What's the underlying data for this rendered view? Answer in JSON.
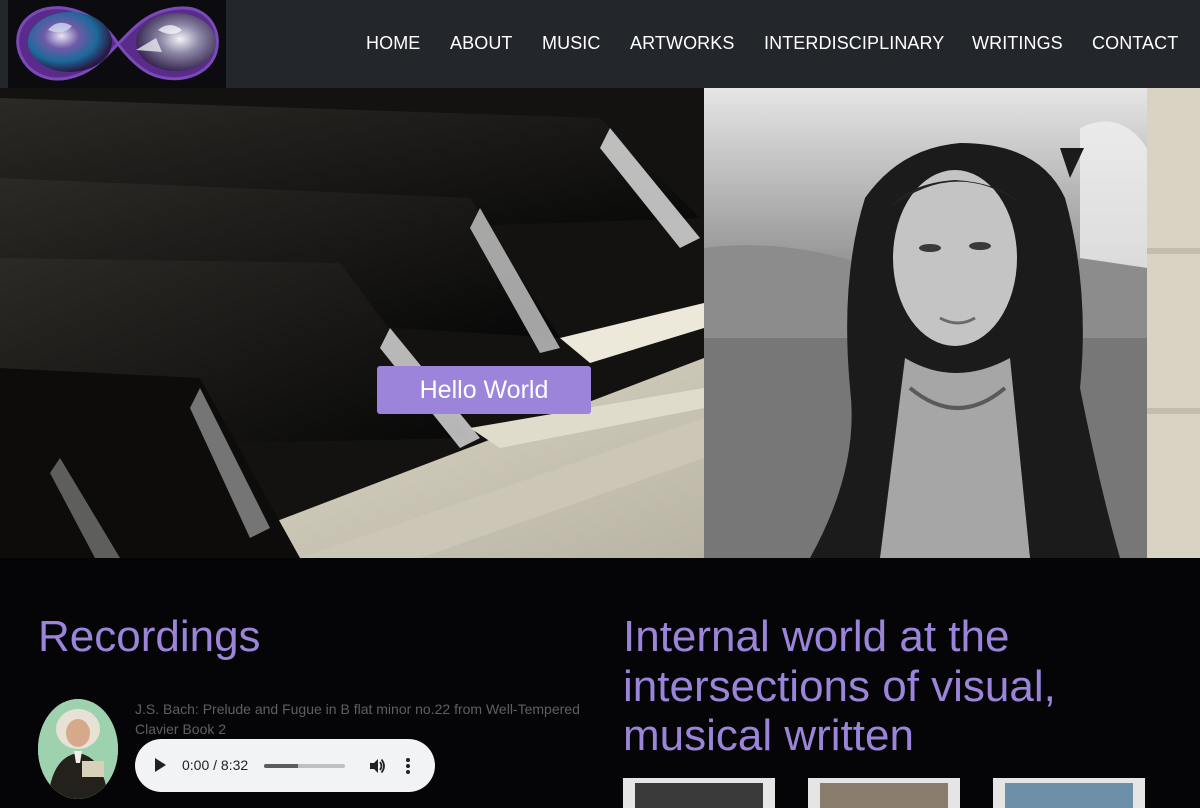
{
  "nav": {
    "items": [
      "HOME",
      "ABOUT",
      "MUSIC",
      "ARTWORKS",
      "INTERDISCIPLINARY",
      "WRITINGS",
      "CONTACT"
    ]
  },
  "hero": {
    "button_label": "Hello World"
  },
  "recordings": {
    "title": "Recordings",
    "tracks": [
      {
        "title": "J.S. Bach: Prelude and Fugue in B flat minor no.22 from Well-Tempered Clavier Book 2",
        "time": "0:00 / 8:32",
        "progress": 0.42
      }
    ]
  },
  "intro": {
    "title": "Internal world at the intersections of visual, musical written"
  },
  "colors": {
    "accent": "#9b84d9",
    "header": "#23262b",
    "background": "#050507"
  },
  "icons": [
    "logo-icon",
    "play-icon",
    "volume-icon",
    "more-options-icon"
  ]
}
